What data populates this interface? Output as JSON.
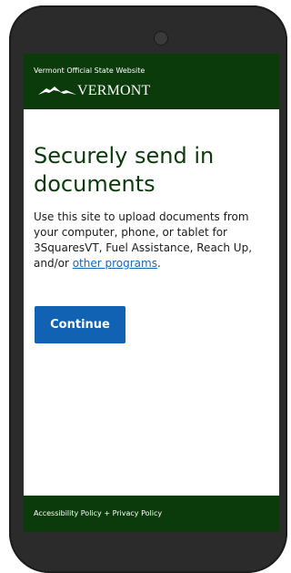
{
  "header": {
    "official_text": "Vermont Official State Website",
    "logo_text": "VERMONT",
    "background": "#0b3a0b"
  },
  "main": {
    "title": "Securely send in documents",
    "description_prefix": "Use this site to upload documents from your computer, phone, or tablet for 3SquaresVT, Fuel Assistance, Reach Up, and/or ",
    "description_link": "other programs",
    "description_suffix": ".",
    "continue_label": "Continue"
  },
  "footer": {
    "accessibility_label": "Accessibility Policy",
    "separator": " + ",
    "privacy_label": "Privacy Policy"
  },
  "colors": {
    "brand_green": "#0b3a0b",
    "button_blue": "#1262b3",
    "link_blue": "#1668b8"
  }
}
